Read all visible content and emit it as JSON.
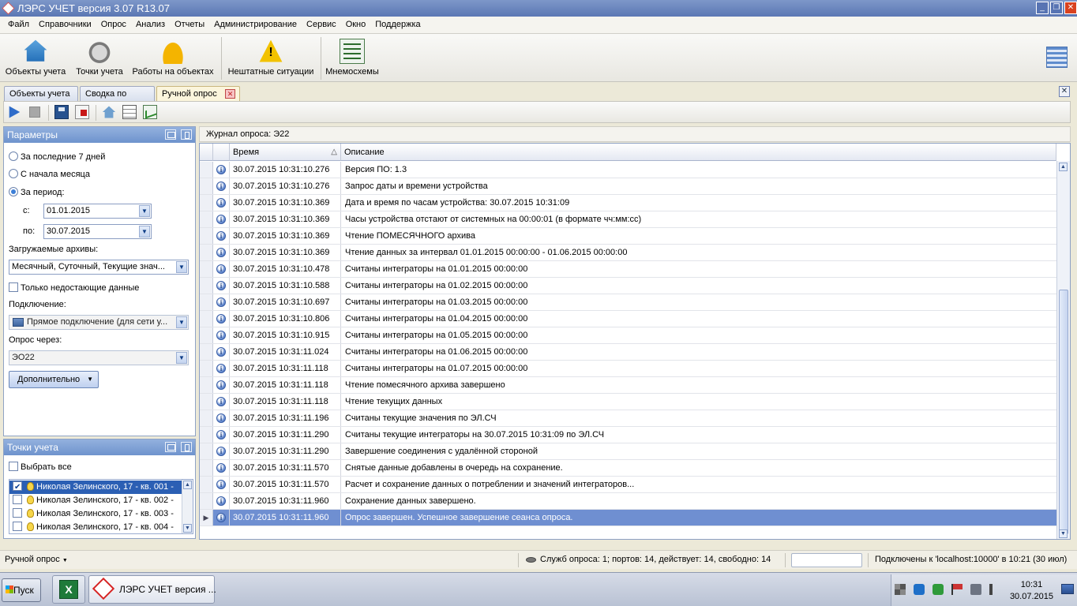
{
  "window": {
    "title": "ЛЭРС УЧЕТ версия 3.07 R13.07",
    "min": "_",
    "max": "❐",
    "close": "✕"
  },
  "menu": [
    "Файл",
    "Справочники",
    "Опрос",
    "Анализ",
    "Отчеты",
    "Администрирование",
    "Сервис",
    "Окно",
    "Поддержка"
  ],
  "ribbon": {
    "objects": "Объекты учета",
    "points": "Точки учета",
    "works": "Работы на объектах",
    "emergency": "Нештатные ситуации",
    "schemes": "Мнемосхемы"
  },
  "tabs": [
    {
      "label": "Объекты учета"
    },
    {
      "label": "Сводка по дому"
    },
    {
      "label": "Ручной опрос",
      "active": true
    }
  ],
  "tab_close": "✕",
  "params": {
    "title": "Параметры",
    "last7": "За последние 7 дней",
    "month_start": "С начала месяца",
    "period": "За период:",
    "from_label": "с:",
    "from_value": "01.01.2015",
    "to_label": "по:",
    "to_value": "30.07.2015",
    "archives_label": "Загружаемые архивы:",
    "archives_value": "Месячный, Суточный, Текущие знач...",
    "missing_only": "Только недостающие данные",
    "connection_label": "Подключение:",
    "connection_value": "Прямое подключение (для сети у...",
    "via_label": "Опрос через:",
    "via_value": "ЭО22",
    "more_button": "Дополнительно"
  },
  "points": {
    "title": "Точки учета",
    "select_all": "Выбрать все",
    "items": [
      {
        "label": "Николая Зелинского, 17 - кв. 001 -",
        "checked": true
      },
      {
        "label": "Николая Зелинского, 17 - кв. 002 -",
        "checked": false
      },
      {
        "label": "Николая Зелинского, 17 - кв. 003 -",
        "checked": false
      },
      {
        "label": "Николая Зелинского, 17 - кв. 004 -",
        "checked": false
      }
    ]
  },
  "journal": {
    "title": "Журнал опроса: Э22",
    "col_time": "Время",
    "col_desc": "Описание",
    "sort_glyph": "△",
    "rows": [
      {
        "time": "30.07.2015 10:31:10.276",
        "desc": "Версия ПО: 1.3"
      },
      {
        "time": "30.07.2015 10:31:10.276",
        "desc": "Запрос даты и времени устройства"
      },
      {
        "time": "30.07.2015 10:31:10.369",
        "desc": "Дата и время по часам устройства: 30.07.2015 10:31:09"
      },
      {
        "time": "30.07.2015 10:31:10.369",
        "desc": "Часы устройства отстают от системных на 00:00:01 (в формате чч:мм:сс)"
      },
      {
        "time": "30.07.2015 10:31:10.369",
        "desc": "Чтение ПОМЕСЯЧНОГО архива"
      },
      {
        "time": "30.07.2015 10:31:10.369",
        "desc": "Чтение данных за интервал 01.01.2015 00:00:00 - 01.06.2015 00:00:00"
      },
      {
        "time": "30.07.2015 10:31:10.478",
        "desc": "Считаны интеграторы на 01.01.2015 00:00:00"
      },
      {
        "time": "30.07.2015 10:31:10.588",
        "desc": "Считаны интеграторы на 01.02.2015 00:00:00"
      },
      {
        "time": "30.07.2015 10:31:10.697",
        "desc": "Считаны интеграторы на 01.03.2015 00:00:00"
      },
      {
        "time": "30.07.2015 10:31:10.806",
        "desc": "Считаны интеграторы на 01.04.2015 00:00:00"
      },
      {
        "time": "30.07.2015 10:31:10.915",
        "desc": "Считаны интеграторы на 01.05.2015 00:00:00"
      },
      {
        "time": "30.07.2015 10:31:11.024",
        "desc": "Считаны интеграторы на 01.06.2015 00:00:00"
      },
      {
        "time": "30.07.2015 10:31:11.118",
        "desc": "Считаны интеграторы на 01.07.2015 00:00:00"
      },
      {
        "time": "30.07.2015 10:31:11.118",
        "desc": "Чтение помесячного архива завершено"
      },
      {
        "time": "30.07.2015 10:31:11.118",
        "desc": "Чтение текущих данных"
      },
      {
        "time": "30.07.2015 10:31:11.196",
        "desc": "Считаны текущие значения по ЭЛ.СЧ"
      },
      {
        "time": "30.07.2015 10:31:11.290",
        "desc": "Считаны текущие интеграторы на 30.07.2015 10:31:09 по ЭЛ.СЧ"
      },
      {
        "time": "30.07.2015 10:31:11.290",
        "desc": "Завершение соединения с удалённой стороной"
      },
      {
        "time": "30.07.2015 10:31:11.570",
        "desc": "Снятые данные добавлены в очередь на сохранение."
      },
      {
        "time": "30.07.2015 10:31:11.570",
        "desc": "Расчет и сохранение данных о потреблении и значений интеграторов..."
      },
      {
        "time": "30.07.2015 10:31:11.960",
        "desc": "Сохранение данных завершено."
      },
      {
        "time": "30.07.2015 10:31:11.960",
        "desc": "Опрос завершен. Успешное завершение сеанса опроса.",
        "selected": true
      }
    ]
  },
  "status": {
    "mode": "Ручной опрос",
    "services": "Служб опроса: 1; портов: 14, действует: 14, свободно: 14",
    "connected": "Подключены к 'localhost:10000' в 10:21 (30 июл)"
  },
  "taskbar": {
    "start": "Пуск",
    "app_label": "ЛЭРС УЧЕТ версия ...",
    "excel_letter": "X",
    "time": "10:31",
    "date": "30.07.2015"
  },
  "colors": {
    "selection": "#6f8fd1",
    "panel_header": "#7ea0d6",
    "accent": "#2b5fb4"
  }
}
